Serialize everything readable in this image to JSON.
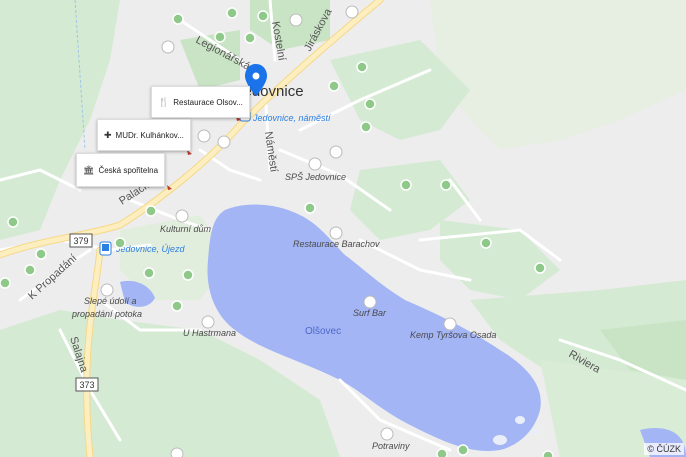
{
  "map": {
    "town_label": "Jedovnice",
    "lake_label": "Olšovec",
    "attribution": "© ČÚZK",
    "colors": {
      "water": "#a3b5f5",
      "road_major": "#fce7a4",
      "green": "#cfe8cf",
      "land": "#ececec"
    }
  },
  "callouts": [
    {
      "icon": "fork-knife-icon",
      "glyph": "🍴",
      "text": "Restaurace Olsov..."
    },
    {
      "icon": "medical-icon",
      "glyph": "✚",
      "text": "MUDr. Kulhánkov..."
    },
    {
      "icon": "bank-icon",
      "glyph": "🏛",
      "text": "Česká spořitelna"
    }
  ],
  "streets": {
    "legionarska": "Legionářská",
    "kostelni": "Kostelní",
    "jiraskova": "Jiráskova",
    "namesti": "Náměstí",
    "palackeho": "Palackého",
    "k_propadani": "K Propadání",
    "salajna": "Salajna",
    "riviera": "Riviera"
  },
  "road_shields": {
    "r379": "379",
    "r373": "373"
  },
  "stops": {
    "namesti": "Jedovnice, náměstí",
    "ujezd": "Jedovnice, Újezd"
  },
  "pois": {
    "sps": "SPŠ Jedovnice",
    "kulturni_dum": "Kulturní dům",
    "barachov": "Restaurace Barachov",
    "surf_bar": "Surf Bar",
    "kemp": "Kemp Tyršova Osada",
    "hastrmana": "U Hastrmana",
    "slepe1": "Slepé údolí a",
    "slepe2": "propadání potoka",
    "potraviny": "Potraviny"
  }
}
